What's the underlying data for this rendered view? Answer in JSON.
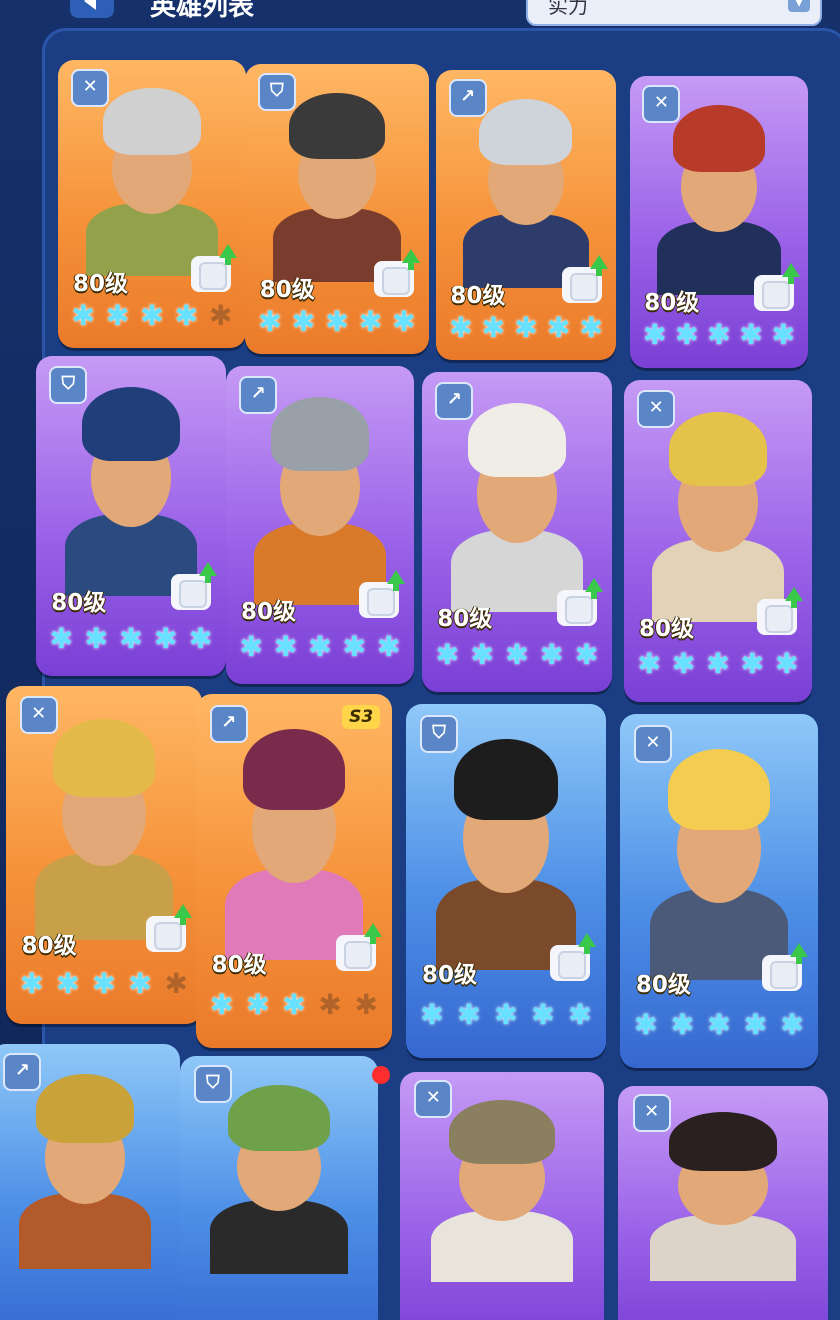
{
  "header": {
    "title": "英雄列表",
    "filter_label": "实力",
    "filter_chevron": "chevron-down-icon"
  },
  "colors": {
    "star_on": "#68e0ff",
    "star_off": "#b0642a",
    "rarity_orange": "#f5923a",
    "rarity_purple": "#9b63e8",
    "rarity_blue": "#4c8ee6",
    "upgrade_arrow": "#39c84a"
  },
  "heroes": [
    {
      "row": 1,
      "col": 1,
      "rarity": "orange",
      "class_icon": "crossbow-icon",
      "level": "80级",
      "stars_on": 4,
      "stars_total": 5,
      "gear": "shirt-icon",
      "upgrade": true
    },
    {
      "row": 1,
      "col": 2,
      "rarity": "orange",
      "class_icon": "shield-icon",
      "level": "80级",
      "stars_on": 5,
      "stars_total": 5,
      "gear": "shirt-icon",
      "upgrade": true
    },
    {
      "row": 1,
      "col": 3,
      "rarity": "orange",
      "class_icon": "spear-icon",
      "level": "80级",
      "stars_on": 5,
      "stars_total": 5,
      "gear": "shirt-icon",
      "upgrade": true
    },
    {
      "row": 1,
      "col": 4,
      "rarity": "purple",
      "class_icon": "crossbow-icon",
      "level": "80级",
      "stars_on": 5,
      "stars_total": 5,
      "gear": "shirt-icon",
      "upgrade": true
    },
    {
      "row": 2,
      "col": 1,
      "rarity": "purple",
      "class_icon": "shield-icon",
      "level": "80级",
      "stars_on": 5,
      "stars_total": 5,
      "gear": "shirt-icon",
      "upgrade": true
    },
    {
      "row": 2,
      "col": 2,
      "rarity": "purple",
      "class_icon": "spear-icon",
      "level": "80级",
      "stars_on": 5,
      "stars_total": 5,
      "gear": "shirt-icon",
      "upgrade": true
    },
    {
      "row": 2,
      "col": 3,
      "rarity": "purple",
      "class_icon": "spear-icon",
      "level": "80级",
      "stars_on": 5,
      "stars_total": 5,
      "gear": "shirt-icon",
      "upgrade": true
    },
    {
      "row": 2,
      "col": 4,
      "rarity": "purple",
      "class_icon": "crossbow-icon",
      "level": "80级",
      "stars_on": 5,
      "stars_total": 5,
      "gear": "skill-book-icon",
      "upgrade": true
    },
    {
      "row": 3,
      "col": 1,
      "rarity": "orange",
      "class_icon": "crossbow-icon",
      "level": "80级",
      "stars_on": 4,
      "stars_total": 5,
      "gear": "shirt-icon",
      "upgrade": true
    },
    {
      "row": 3,
      "col": 2,
      "rarity": "orange",
      "class_icon": "spear-icon",
      "level": "80级",
      "stars_on": 3,
      "stars_total": 5,
      "gear": "shirt-icon",
      "upgrade": true,
      "season": "S3"
    },
    {
      "row": 3,
      "col": 3,
      "rarity": "blue",
      "class_icon": "shield-icon",
      "level": "80级",
      "stars_on": 5,
      "stars_total": 5,
      "gear": "shirt-icon",
      "upgrade": true
    },
    {
      "row": 3,
      "col": 4,
      "rarity": "blue",
      "class_icon": "crossbow-icon",
      "level": "80级",
      "stars_on": 5,
      "stars_total": 5,
      "gear": "shirt-icon",
      "upgrade": true
    },
    {
      "row": 4,
      "col": 1,
      "rarity": "blue",
      "class_icon": "spear-icon"
    },
    {
      "row": 4,
      "col": 2,
      "rarity": "blue",
      "class_icon": "shield-icon",
      "notification": true
    },
    {
      "row": 4,
      "col": 3,
      "rarity": "purple",
      "class_icon": "crossbow-icon"
    },
    {
      "row": 4,
      "col": 4,
      "rarity": "purple",
      "class_icon": "crossbow-icon"
    }
  ]
}
